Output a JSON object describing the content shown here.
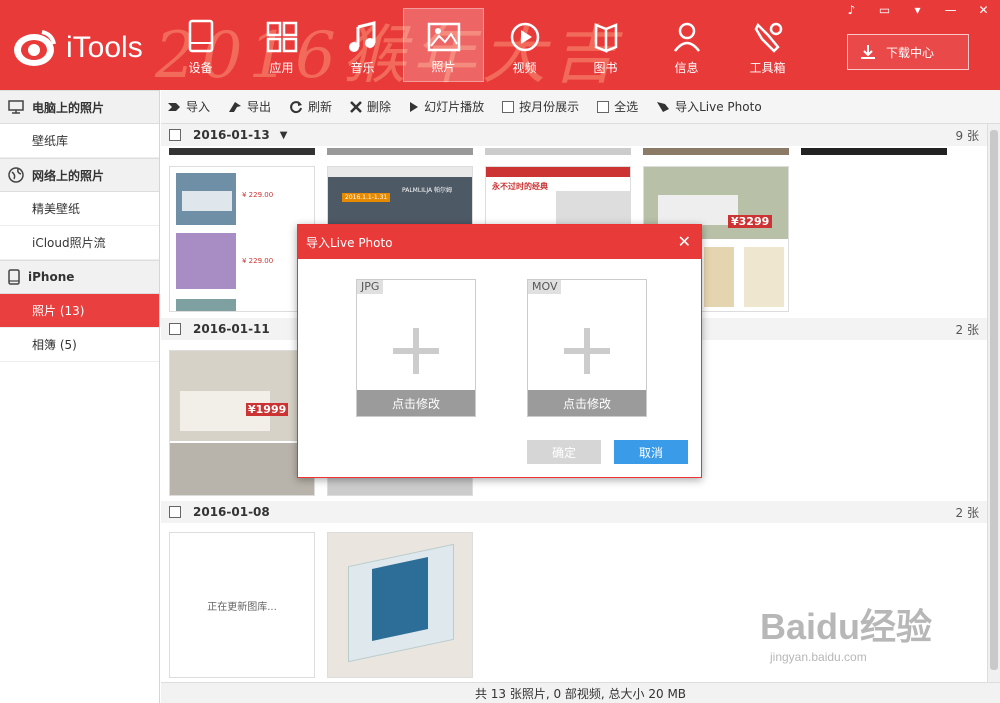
{
  "header": {
    "app_name": "iTools",
    "deco_text": "2016猴年大吉",
    "nav": [
      {
        "label": "设备",
        "icon": "device-icon"
      },
      {
        "label": "应用",
        "icon": "apps-icon"
      },
      {
        "label": "音乐",
        "icon": "music-icon"
      },
      {
        "label": "照片",
        "icon": "photo-icon",
        "active": true
      },
      {
        "label": "视频",
        "icon": "video-icon"
      },
      {
        "label": "图书",
        "icon": "book-icon"
      },
      {
        "label": "信息",
        "icon": "user-icon"
      },
      {
        "label": "工具箱",
        "icon": "wrench-icon"
      }
    ],
    "download_label": "下载中心",
    "accent_color": "#e93a3a"
  },
  "sidebar": {
    "sections": [
      {
        "title": "电脑上的照片",
        "icon": "monitor-icon",
        "items": [
          {
            "label": "壁纸库"
          }
        ]
      },
      {
        "title": "网络上的照片",
        "icon": "globe-icon",
        "items": [
          {
            "label": "精美壁纸"
          },
          {
            "label": "iCloud照片流"
          }
        ]
      },
      {
        "title": "iPhone",
        "icon": "phone-icon",
        "items": [
          {
            "label": "照片 (13)",
            "active": true
          },
          {
            "label": "相簿 (5)"
          }
        ]
      }
    ]
  },
  "toolbar": {
    "import": "导入",
    "export": "导出",
    "refresh": "刷新",
    "delete": "删除",
    "slideshow": "幻灯片播放",
    "by_month": "按月份展示",
    "select_all": "全选",
    "import_live": "导入Live Photo"
  },
  "groups": [
    {
      "date": "2016-01-13",
      "count": "9 张"
    },
    {
      "date": "2016-01-11",
      "count": "2 张"
    },
    {
      "date": "2016-01-08",
      "count": "2 张"
    }
  ],
  "thumbs": {
    "t1_p1": "¥ 229.00",
    "t1_p2": "¥ 229.00",
    "t2_brand": "PALMLILJA 帕尔姆",
    "t2_date": "2016.1.1-1.31",
    "t3_head": "永不过时的经典",
    "t4_price": "¥3299",
    "t5_price": "¥1999",
    "loading": "正在更新图库..."
  },
  "dialog": {
    "title": "导入Live Photo",
    "jpg_label": "JPG",
    "mov_label": "MOV",
    "modify": "点击修改",
    "confirm": "确定",
    "cancel": "取消"
  },
  "status": "共 13 张照片, 0 部视频, 总大小 20 MB",
  "watermark": {
    "main": "Baidu经验",
    "sub": "jingyan.baidu.com"
  }
}
